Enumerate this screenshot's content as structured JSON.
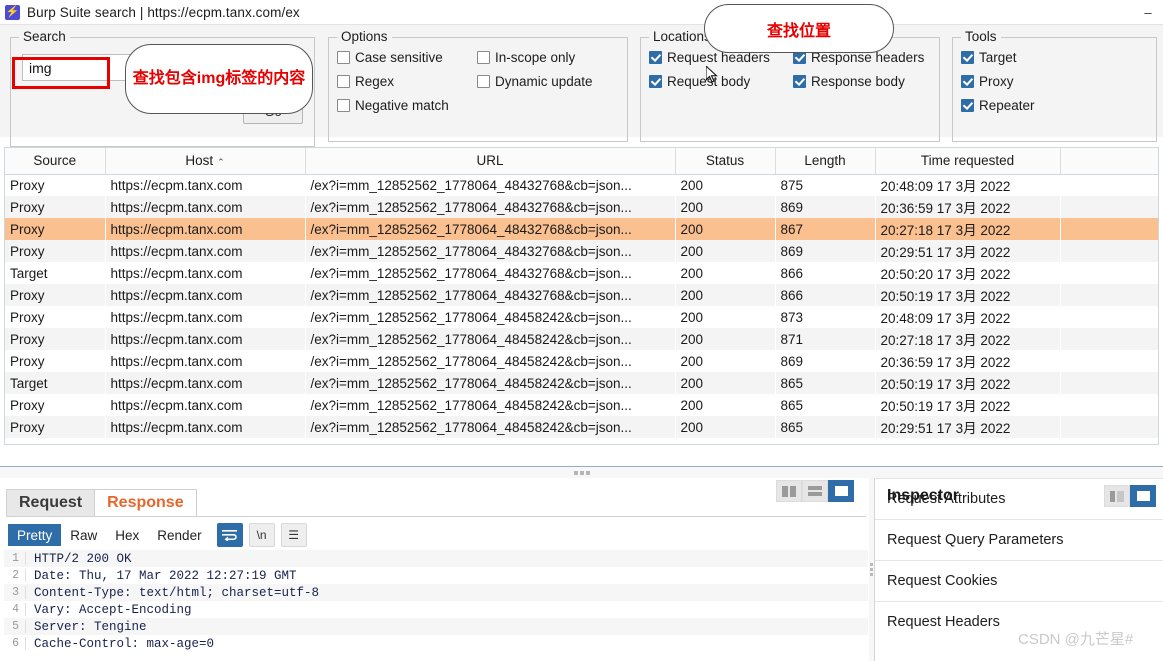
{
  "window": {
    "title": "Burp Suite search | https://ecpm.tanx.com/ex",
    "app_icon": "burp-lightning-icon",
    "minimize_label": "–"
  },
  "search": {
    "legend": "Search",
    "value": "img",
    "placeholder": "",
    "go_label": "Go"
  },
  "options": {
    "legend": "Options",
    "items": [
      {
        "label": "Case sensitive",
        "checked": false
      },
      {
        "label": "In-scope only",
        "checked": false
      },
      {
        "label": "Regex",
        "checked": false
      },
      {
        "label": "Dynamic update",
        "checked": false
      },
      {
        "label": "Negative match",
        "checked": false
      }
    ]
  },
  "locations": {
    "legend": "Locations",
    "items": [
      {
        "label": "Request headers",
        "checked": true
      },
      {
        "label": "Response headers",
        "checked": true
      },
      {
        "label": "Request body",
        "checked": true
      },
      {
        "label": "Response body",
        "checked": true
      }
    ]
  },
  "tools": {
    "legend": "Tools",
    "items": [
      {
        "label": "Target",
        "checked": true
      },
      {
        "label": "Proxy",
        "checked": true
      },
      {
        "label": "Repeater",
        "checked": true
      }
    ]
  },
  "annotations": [
    {
      "name": "search-callout",
      "text": "查找包含img标签的内容",
      "color": "#e60000"
    },
    {
      "name": "locations-callout",
      "text": "查找位置",
      "color": "#e60000"
    }
  ],
  "results_table": {
    "columns": [
      "Source",
      "Host",
      "URL",
      "Status",
      "Length",
      "Time requested",
      ""
    ],
    "sorted_column": "Host",
    "sort_direction": "asc",
    "sort_caret": "⌃",
    "selected_row_index": 2,
    "rows": [
      {
        "source": "Proxy",
        "host": "https://ecpm.tanx.com",
        "url": "/ex?i=mm_12852562_1778064_48432768&cb=json...",
        "status": "200",
        "length": "875",
        "time": "20:48:09 17 3月 2022"
      },
      {
        "source": "Proxy",
        "host": "https://ecpm.tanx.com",
        "url": "/ex?i=mm_12852562_1778064_48432768&cb=json...",
        "status": "200",
        "length": "869",
        "time": "20:36:59 17 3月 2022"
      },
      {
        "source": "Proxy",
        "host": "https://ecpm.tanx.com",
        "url": "/ex?i=mm_12852562_1778064_48432768&cb=json...",
        "status": "200",
        "length": "867",
        "time": "20:27:18 17 3月 2022"
      },
      {
        "source": "Proxy",
        "host": "https://ecpm.tanx.com",
        "url": "/ex?i=mm_12852562_1778064_48432768&cb=json...",
        "status": "200",
        "length": "869",
        "time": "20:29:51 17 3月 2022"
      },
      {
        "source": "Target",
        "host": "https://ecpm.tanx.com",
        "url": "/ex?i=mm_12852562_1778064_48432768&cb=json...",
        "status": "200",
        "length": "866",
        "time": "20:50:20 17 3月 2022"
      },
      {
        "source": "Proxy",
        "host": "https://ecpm.tanx.com",
        "url": "/ex?i=mm_12852562_1778064_48432768&cb=json...",
        "status": "200",
        "length": "866",
        "time": "20:50:19 17 3月 2022"
      },
      {
        "source": "Proxy",
        "host": "https://ecpm.tanx.com",
        "url": "/ex?i=mm_12852562_1778064_48458242&cb=json...",
        "status": "200",
        "length": "873",
        "time": "20:48:09 17 3月 2022"
      },
      {
        "source": "Proxy",
        "host": "https://ecpm.tanx.com",
        "url": "/ex?i=mm_12852562_1778064_48458242&cb=json...",
        "status": "200",
        "length": "871",
        "time": "20:27:18 17 3月 2022"
      },
      {
        "source": "Proxy",
        "host": "https://ecpm.tanx.com",
        "url": "/ex?i=mm_12852562_1778064_48458242&cb=json...",
        "status": "200",
        "length": "869",
        "time": "20:36:59 17 3月 2022"
      },
      {
        "source": "Target",
        "host": "https://ecpm.tanx.com",
        "url": "/ex?i=mm_12852562_1778064_48458242&cb=json...",
        "status": "200",
        "length": "865",
        "time": "20:50:19 17 3月 2022"
      },
      {
        "source": "Proxy",
        "host": "https://ecpm.tanx.com",
        "url": "/ex?i=mm_12852562_1778064_48458242&cb=json...",
        "status": "200",
        "length": "865",
        "time": "20:50:19 17 3月 2022"
      },
      {
        "source": "Proxy",
        "host": "https://ecpm.tanx.com",
        "url": "/ex?i=mm_12852562_1778064_48458242&cb=json...",
        "status": "200",
        "length": "865",
        "time": "20:29:51 17 3月 2022"
      }
    ]
  },
  "message_panel": {
    "tabs": [
      {
        "label": "Request",
        "active": false
      },
      {
        "label": "Response",
        "active": true
      }
    ],
    "view_toggles": [
      {
        "name": "split-vertical-icon",
        "active": false
      },
      {
        "name": "split-horizontal-icon",
        "active": false
      },
      {
        "name": "single-pane-icon",
        "active": true
      }
    ],
    "format_buttons": [
      {
        "label": "Pretty",
        "active": true
      },
      {
        "label": "Raw",
        "active": false
      },
      {
        "label": "Hex",
        "active": false
      },
      {
        "label": "Render",
        "active": false
      }
    ],
    "icon_buttons": [
      {
        "name": "word-wrap-icon",
        "label": "⇥",
        "active": true
      },
      {
        "name": "newline-icon",
        "label": "\\n",
        "active": false
      },
      {
        "name": "menu-icon",
        "label": "☰",
        "active": false
      }
    ],
    "code_lines": [
      {
        "no": "1",
        "text": "HTTP/2 200 OK"
      },
      {
        "no": "2",
        "text": "Date: Thu, 17 Mar 2022 12:27:19 GMT"
      },
      {
        "no": "3",
        "text": "Content-Type: text/html; charset=utf-8"
      },
      {
        "no": "4",
        "text": "Vary: Accept-Encoding"
      },
      {
        "no": "5",
        "text": "Server: Tengine"
      },
      {
        "no": "6",
        "text": "Cache-Control: max-age=0"
      }
    ]
  },
  "inspector": {
    "title": "Inspector",
    "toggles": [
      {
        "name": "inspector-collapse-icon",
        "active": false
      },
      {
        "name": "inspector-expand-icon",
        "active": true
      }
    ],
    "sections": [
      "Request Attributes",
      "Request Query Parameters",
      "Request Cookies",
      "Request Headers"
    ]
  },
  "watermark": "CSDN @九芒星#"
}
